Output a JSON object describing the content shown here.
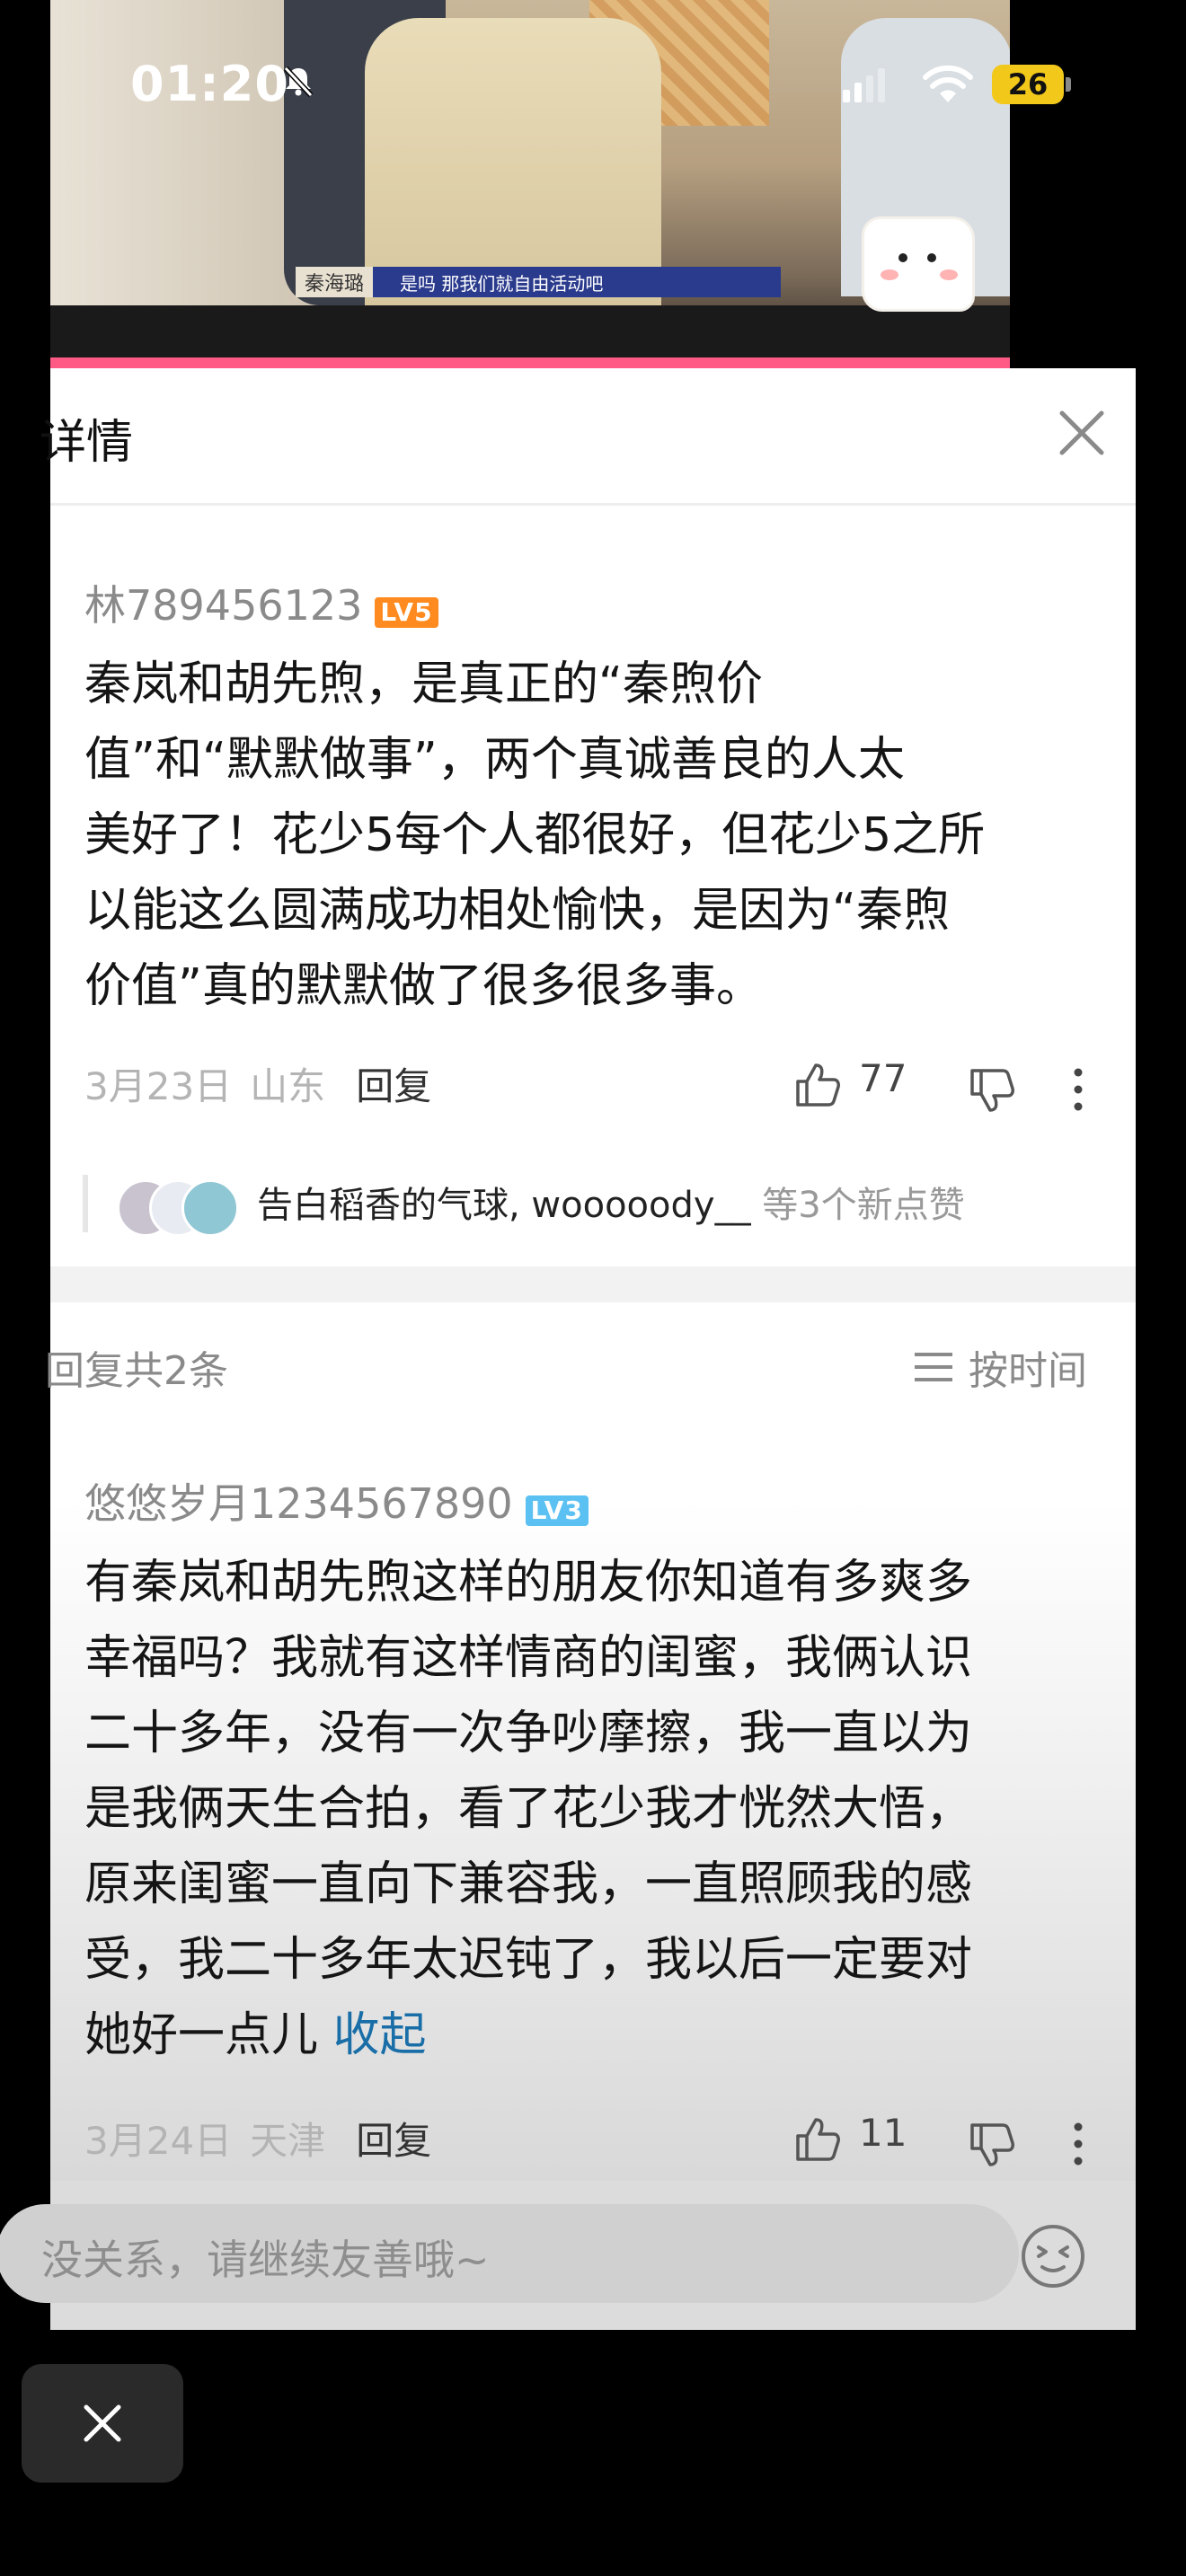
{
  "status_bar": {
    "time": "01:20",
    "battery": "26",
    "icons": [
      "bell-muted-icon",
      "cellular-icon",
      "wifi-icon",
      "battery-icon"
    ]
  },
  "video": {
    "subtitle_name": "秦海璐",
    "subtitle_text": "是吗 那我们就自由活动吧"
  },
  "panel": {
    "title": "详情",
    "close_icon": "close-icon"
  },
  "comment": {
    "username": "林789456123",
    "level": "LV5",
    "text_lines": [
      "秦岚和胡先煦，是真正的“秦煦价",
      "值”和“默默做事”，两个真诚善良的人太",
      "美好了！花少5每个人都很好，但花少5之所",
      "以能这么圆满成功相处愉快，是因为“秦煦",
      "价值”真的默默做了很多很多事。"
    ],
    "date": "3月23日",
    "location": "山东",
    "reply_label": "回复",
    "like_count": "77",
    "likers": "告白稻香的气球, wooooody__",
    "likers_suffix": "等3个新点赞"
  },
  "replies_header": {
    "count_label": "回复共2条",
    "sort_label": "按时间"
  },
  "reply": {
    "username": "悠悠岁月1234567890",
    "level": "LV3",
    "text_lines": [
      "有秦岚和胡先煦这样的朋友你知道有多爽多",
      "幸福吗？我就有这样情商的闺蜜，我俩认识",
      "二十多年，没有一次争吵摩擦，我一直以为",
      "是我俩天生合拍，看了花少我才恍然大悟，",
      "原来闺蜜一直向下兼容我，一直照顾我的感",
      "受，我二十多年太迟钝了，我以后一定要对"
    ],
    "last_line": "她好一点儿",
    "collapse_label": "收起",
    "date": "3月24日",
    "location": "天津",
    "reply_label": "回复",
    "like_count": "11"
  },
  "input": {
    "placeholder": "没关系，请继续友善哦~"
  }
}
